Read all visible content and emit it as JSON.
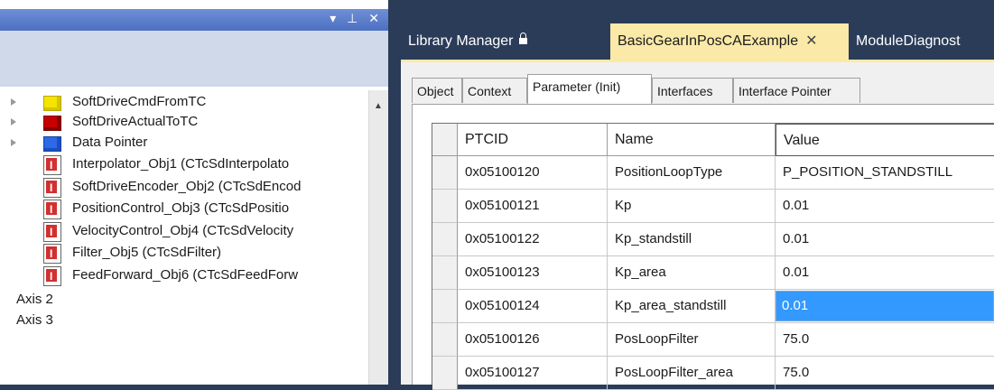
{
  "left_panel": {
    "title_buttons": "▾ ⊥ ✕",
    "tree": [
      {
        "label": "SoftDriveCmdFromTC",
        "icon": "yellow-box-icon",
        "expandable": true
      },
      {
        "label": "SoftDriveActualToTC",
        "icon": "red-box-icon",
        "expandable": true
      },
      {
        "label": "Data Pointer",
        "icon": "blue-box-icon",
        "expandable": true
      },
      {
        "label": "Interpolator_Obj1 (CTcSdInterpolato",
        "icon": "tcom-object-icon",
        "expandable": false
      },
      {
        "label": "SoftDriveEncoder_Obj2 (CTcSdEncod",
        "icon": "tcom-object-icon",
        "expandable": false
      },
      {
        "label": "PositionControl_Obj3 (CTcSdPositio",
        "icon": "tcom-object-icon",
        "expandable": false
      },
      {
        "label": "VelocityControl_Obj4 (CTcSdVelocity",
        "icon": "tcom-object-icon",
        "expandable": false
      },
      {
        "label": "Filter_Obj5 (CTcSdFilter)",
        "icon": "tcom-object-icon",
        "expandable": false
      },
      {
        "label": "FeedForward_Obj6 (CTcSdFeedForw",
        "icon": "tcom-object-icon",
        "expandable": false
      },
      {
        "label": "Axis 2",
        "icon": "",
        "expandable": false
      },
      {
        "label": "Axis 3",
        "icon": "",
        "expandable": false
      }
    ]
  },
  "doc_tabs": [
    {
      "label": "Library Manager",
      "state": "inactive",
      "locked": true
    },
    {
      "label": "BasicGearInPosCAExample",
      "state": "active",
      "close": "✕"
    },
    {
      "label": "ModuleDiagnost",
      "state": "inactive"
    }
  ],
  "inner_tabs": [
    "Object",
    "Context",
    "Parameter (Init)",
    "Interfaces",
    "Interface Pointer"
  ],
  "active_inner_tab": "Parameter (Init)",
  "grid": {
    "columns": [
      "PTCID",
      "Name",
      "Value"
    ],
    "rows": [
      {
        "ptcid": "0x05100120",
        "name": "PositionLoopType",
        "value": "P_POSITION_STANDSTILL"
      },
      {
        "ptcid": "0x05100121",
        "name": "Kp",
        "value": "0.01"
      },
      {
        "ptcid": "0x05100122",
        "name": "Kp_standstill",
        "value": "0.01"
      },
      {
        "ptcid": "0x05100123",
        "name": "Kp_area",
        "value": "0.01"
      },
      {
        "ptcid": "0x05100124",
        "name": "Kp_area_standstill",
        "value": "0.01"
      },
      {
        "ptcid": "0x05100126",
        "name": "PosLoopFilter",
        "value": "75.0"
      },
      {
        "ptcid": "0x05100127",
        "name": "PosLoopFilter_area",
        "value": "75.0"
      }
    ],
    "editing_row": 4
  },
  "colors": {
    "frame": "#2b3c59",
    "active_tab": "#fbe9a8",
    "selection": "#3399ff"
  }
}
